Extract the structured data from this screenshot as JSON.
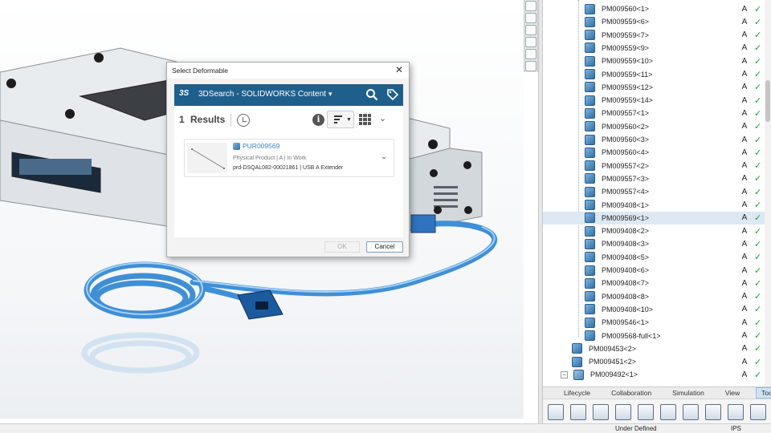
{
  "dialog": {
    "title": "Select Deformable",
    "close_glyph": "✕",
    "app_selector": "3DSearch - SOLIDWORKS Content",
    "logo_text": "3S",
    "results_count": "1",
    "results_label": "Results",
    "info_glyph": "i",
    "result": {
      "name": "PUR009569",
      "meta": "Physical Product | A | In Work",
      "description": "prd-DSQAL082-00021861 | USB A Extender"
    },
    "ok_label": "OK",
    "cancel_label": "Cancel"
  },
  "tree": {
    "rows": [
      {
        "label": "PM009560<1>",
        "rev": "A",
        "level": 2
      },
      {
        "label": "PM009559<6>",
        "rev": "A",
        "level": 2
      },
      {
        "label": "PM009559<7>",
        "rev": "A",
        "level": 2
      },
      {
        "label": "PM009559<9>",
        "rev": "A",
        "level": 2
      },
      {
        "label": "PM009559<10>",
        "rev": "A",
        "level": 2
      },
      {
        "label": "PM009559<11>",
        "rev": "A",
        "level": 2
      },
      {
        "label": "PM009559<12>",
        "rev": "A",
        "level": 2
      },
      {
        "label": "PM009559<14>",
        "rev": "A",
        "level": 2
      },
      {
        "label": "PM009557<1>",
        "rev": "A",
        "level": 2
      },
      {
        "label": "PM009560<2>",
        "rev": "A",
        "level": 2
      },
      {
        "label": "PM009560<3>",
        "rev": "A",
        "level": 2
      },
      {
        "label": "PM009560<4>",
        "rev": "A",
        "level": 2
      },
      {
        "label": "PM009557<2>",
        "rev": "A",
        "level": 2
      },
      {
        "label": "PM009557<3>",
        "rev": "A",
        "level": 2
      },
      {
        "label": "PM009557<4>",
        "rev": "A",
        "level": 2
      },
      {
        "label": "PM009408<1>",
        "rev": "A",
        "level": 2
      },
      {
        "label": "PM009569<1>",
        "rev": "A",
        "level": 2,
        "selected": true
      },
      {
        "label": "PM009408<2>",
        "rev": "A",
        "level": 2
      },
      {
        "label": "PM009408<3>",
        "rev": "A",
        "level": 2
      },
      {
        "label": "PM009408<5>",
        "rev": "A",
        "level": 2
      },
      {
        "label": "PM009408<6>",
        "rev": "A",
        "level": 2
      },
      {
        "label": "PM009408<7>",
        "rev": "A",
        "level": 2
      },
      {
        "label": "PM009408<8>",
        "rev": "A",
        "level": 2
      },
      {
        "label": "PM009408<10>",
        "rev": "A",
        "level": 2
      },
      {
        "label": "PM009546<1>",
        "rev": "A",
        "level": 2
      },
      {
        "label": "PM009568-full<1>",
        "rev": "A",
        "level": 2
      },
      {
        "label": "PM009453<2>",
        "rev": "A",
        "level": 1
      },
      {
        "label": "PM009451<2>",
        "rev": "A",
        "level": 1
      },
      {
        "label": "PM009492<1>",
        "rev": "A",
        "level": 1,
        "expander": "−",
        "assembly": true
      }
    ],
    "check_glyph": "✓"
  },
  "command_tabs": [
    "Lifecycle",
    "Collaboration",
    "Simulation",
    "View",
    "Tools"
  ],
  "active_tab": "Tools",
  "status": {
    "state": "Under Defined",
    "units": "IPS"
  },
  "colors": {
    "accent_blue": "#1f5f8c",
    "link_blue": "#3b82c4",
    "check_green": "#1aa036",
    "cable_blue": "#3f8fd6"
  }
}
